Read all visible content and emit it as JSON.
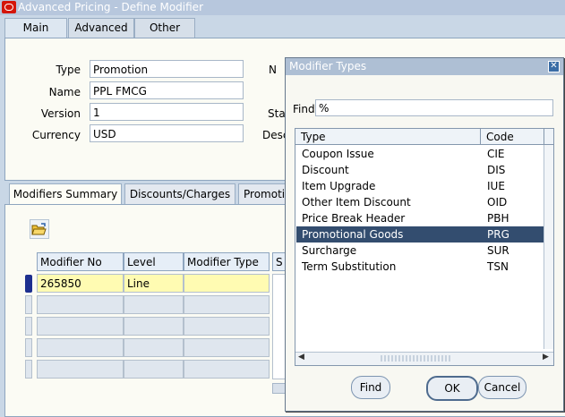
{
  "window": {
    "title": "Advanced Pricing - Define Modifier"
  },
  "top_tabs": [
    {
      "label": "Main"
    },
    {
      "label": "Advanced"
    },
    {
      "label": "Other"
    }
  ],
  "header_form": {
    "type_label": "Type",
    "type_value": "Promotion",
    "name_label": "Name",
    "name_value": "PPL FMCG",
    "version_label": "Version",
    "version_value": "1",
    "currency_label": "Currency",
    "currency_value": "USD",
    "number_label_partial": "N",
    "status_label_partial": "Sta",
    "description_label_partial": "Desc"
  },
  "lower_tabs": [
    {
      "label": "Modifiers Summary"
    },
    {
      "label": "Discounts/Charges"
    },
    {
      "label": "Promotio"
    }
  ],
  "grid": {
    "columns": [
      "Modifier No",
      "Level",
      "Modifier Type",
      "S"
    ],
    "rows": [
      {
        "modifier_no": "265850",
        "level": "Line",
        "modifier_type": ""
      }
    ]
  },
  "dialog": {
    "title": "Modifier Types",
    "find_label": "Find",
    "find_value": "%",
    "columns": [
      "Type",
      "Code"
    ],
    "rows": [
      {
        "type": "Coupon Issue",
        "code": "CIE"
      },
      {
        "type": "Discount",
        "code": "DIS"
      },
      {
        "type": "Item Upgrade",
        "code": "IUE"
      },
      {
        "type": "Other Item Discount",
        "code": "OID"
      },
      {
        "type": "Price Break Header",
        "code": "PBH"
      },
      {
        "type": "Promotional Goods",
        "code": "PRG"
      },
      {
        "type": "Surcharge",
        "code": "SUR"
      },
      {
        "type": "Term Substitution",
        "code": "TSN"
      }
    ],
    "selected_index": 5,
    "buttons": {
      "find": "Find",
      "ok": "OK",
      "cancel": "Cancel"
    }
  },
  "icons": {
    "app": "oracle-icon",
    "open": "folder-open-icon",
    "close": "close-icon"
  }
}
